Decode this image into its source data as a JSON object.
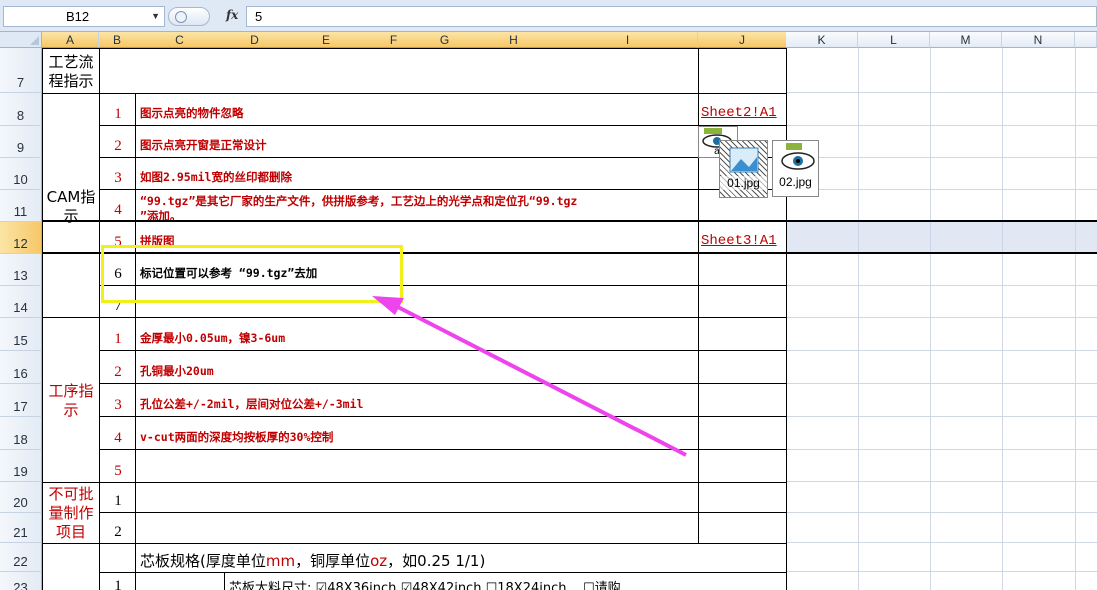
{
  "formula_bar": {
    "name_box": "B12",
    "fx_label": "fx",
    "formula": "5"
  },
  "columns": [
    "A",
    "B",
    "C",
    "D",
    "E",
    "F",
    "G",
    "H",
    "I",
    "J",
    "K",
    "L",
    "M",
    "N"
  ],
  "rows": [
    "7",
    "8",
    "9",
    "10",
    "11",
    "12",
    "13",
    "14",
    "15",
    "16",
    "17",
    "18",
    "19",
    "20",
    "21",
    "22",
    "23"
  ],
  "sections": {
    "flow": "工艺流程指示",
    "cam": "CAM指示",
    "process": "工序指示",
    "nobatch": "不可批量制作项目"
  },
  "cam_items": [
    {
      "num": "1",
      "text": "图示点亮的物件忽略"
    },
    {
      "num": "2",
      "text": "图示点亮开窗是正常设计"
    },
    {
      "num": "3",
      "text": "如图2.95mil宽的丝印都删除"
    },
    {
      "num": "4",
      "text": "“99.tgz”是其它厂家的生产文件，供拼版参考，工艺边上的光学点和定位孔“99.tgz",
      "text2": "”添加。"
    },
    {
      "num": "5",
      "text": "拼版图"
    },
    {
      "num": "6",
      "text": "标记位置可以参考 “99.tgz”去加"
    },
    {
      "num": "7",
      "text": ""
    }
  ],
  "process_items": [
    {
      "num": "1",
      "text": "金厚最小0.05um，镍3-6um"
    },
    {
      "num": "2",
      "text": "孔铜最小20um"
    },
    {
      "num": "3",
      "text": "孔位公差+/-2mil，层间对位公差+/-3mil"
    },
    {
      "num": "4",
      "text": "v-cut两面的深度均按板厚的30%控制"
    },
    {
      "num": "5",
      "text": ""
    }
  ],
  "nobatch_items": [
    {
      "num": "1"
    },
    {
      "num": "2"
    }
  ],
  "links": {
    "sheet2": "Sheet2!A1",
    "sheet3": "Sheet3!A1"
  },
  "images": {
    "img1": "01.jpg",
    "img2": "02.jpg",
    "img_small": "aj"
  },
  "core_spec": {
    "title_a": "芯板规格(厚度单位",
    "title_mm": "mm",
    "title_b": "，铜厚单位",
    "title_oz": "oz",
    "title_c": "，如0.25 1/1)",
    "row_num": "1",
    "size_label": "芯板大料尺寸:",
    "opt1": "48X36inch",
    "opt2": "48X42inch",
    "opt3": "18X24inch",
    "opt4": "请购"
  },
  "colors": {
    "accent_red": "#c00000",
    "highlight": "#f2f01a",
    "arrow": "#ee44ee"
  }
}
